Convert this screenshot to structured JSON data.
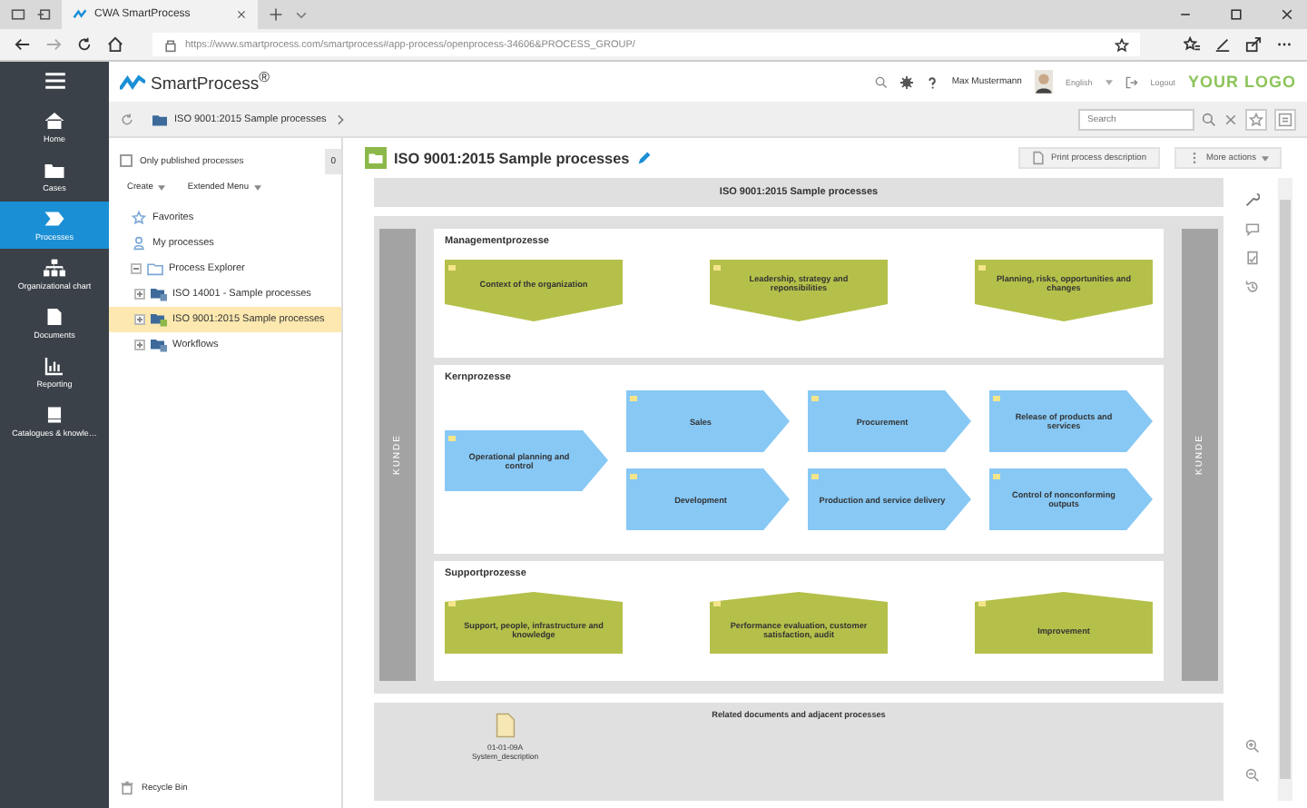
{
  "browser": {
    "tab_title": "CWA SmartProcess",
    "url": "https://www.smartprocess.com/smartprocess#app-process/openprocess-34606&PROCESS_GROUP/"
  },
  "nav": [
    {
      "label": "Home",
      "selected": false
    },
    {
      "label": "Cases",
      "selected": false
    },
    {
      "label": "Processes",
      "selected": true
    },
    {
      "label": "Organizational chart",
      "selected": false
    },
    {
      "label": "Documents",
      "selected": false
    },
    {
      "label": "Reporting",
      "selected": false
    },
    {
      "label": "Catalogues & knowle…",
      "selected": false
    }
  ],
  "header": {
    "brand": "SmartProcess$^{®}$",
    "user": "Max Mustermann",
    "language": "English",
    "logout": "Logout",
    "logo": "YOUR LOGO"
  },
  "breadcrumb": {
    "item": "ISO 9001:2015 Sample processes",
    "search": {
      "placeholder": "Search"
    }
  },
  "left_panel": {
    "only_published": {
      "label": "Only published processes",
      "checked": false
    },
    "count": "0",
    "menus": [
      "Create",
      "Extended Menu"
    ],
    "tree": [
      {
        "label": "Favorites",
        "selected": false
      },
      {
        "label": "My processes",
        "selected": false
      },
      {
        "label": "Process Explorer",
        "selected": false,
        "expanded": true,
        "children": [
          {
            "label": "ISO 14001 - Sample processes",
            "selected": false,
            "expanded": false
          },
          {
            "label": "ISO 9001:2015 Sample processes",
            "selected": true,
            "expanded": false
          },
          {
            "label": "Workflows",
            "selected": false,
            "expanded": false
          }
        ]
      }
    ],
    "recycle_bin": "Recycle Bin"
  },
  "main": {
    "title": "ISO 9001:2015 Sample processes",
    "actions": [
      "Print process description",
      "More actions"
    ],
    "diagram": {
      "title": "ISO 9001:2015 Sample processes",
      "side_labels": [
        "KUNDE",
        "KUNDE"
      ],
      "sections": [
        {
          "title": "Managementprozesse",
          "kind": "management",
          "processes": [
            "Context of the organization",
            "Leadership, strategy and reponsibilities",
            "Planning, risks, opportunities and changes"
          ]
        },
        {
          "title": "Kernprozesse",
          "kind": "core",
          "processes": [
            "Operational planning and control",
            "Sales",
            "Procurement",
            "Release of products and services",
            "Development",
            "Production and service delivery",
            "Control of nonconforming outputs"
          ]
        },
        {
          "title": "Supportprozesse",
          "kind": "support",
          "processes": [
            "Support, people, infrastructure and knowledge",
            "Performance evaluation, customer satisfaction, audit",
            "Improvement"
          ]
        }
      ],
      "related": {
        "title": "Related documents and adjacent processes",
        "documents": [
          {
            "code": "01-01-09A",
            "name": "System_description"
          }
        ]
      }
    }
  }
}
